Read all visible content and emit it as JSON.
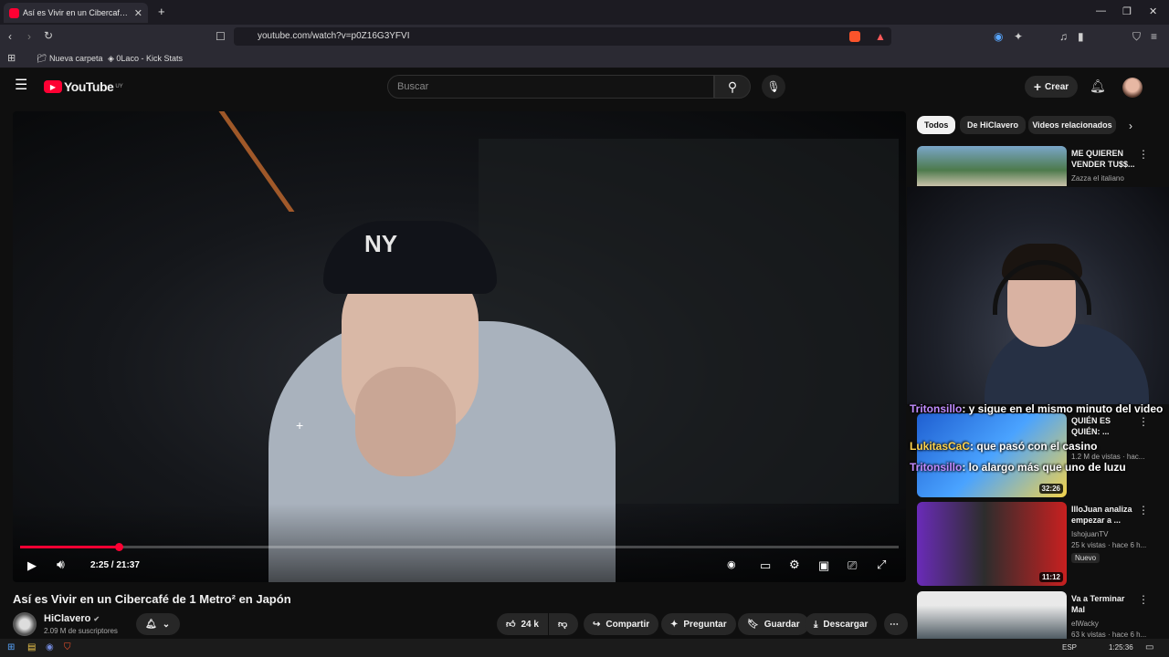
{
  "browser": {
    "tab_title": "Así es Vivir en un Cibercafé de 1 Metro² en Japón",
    "url": "youtube.com/watch?v=p0Z16G3YFVI",
    "bookmarks": [
      "Nueva carpeta",
      "0Laco - Kick Stats"
    ]
  },
  "youtube": {
    "logo": "YouTube",
    "region": "UY",
    "search_placeholder": "Buscar",
    "create_label": "Crear"
  },
  "player": {
    "time": "2:25 / 21:37",
    "progress_fraction": 0.112
  },
  "video": {
    "title": "Así es Vivir en un Cibercafé de 1 Metro² en Japón",
    "channel": "HiClavero",
    "subscribers": "2.09 M de suscriptores",
    "likes": "24 k",
    "actions": {
      "share": "Compartir",
      "ask": "Preguntar",
      "save": "Guardar",
      "download": "Descargar"
    }
  },
  "chips": [
    "Todos",
    "De HiClavero",
    "Videos relacionados"
  ],
  "recommendations": [
    {
      "title": "ME QUIEREN VENDER TU$$...",
      "channel": "Zazza el italiano",
      "meta": "",
      "duration": "",
      "badge": ""
    },
    {
      "title": "QUIÉN ES QUIÉN: ...",
      "channel": "",
      "meta": "1.2 M de vistas · hac...",
      "duration": "32:26",
      "badge": ""
    },
    {
      "title": "IlloJuan analiza empezar a ...",
      "channel": "IshojuanTV",
      "meta": "25 k vistas · hace 6 h...",
      "duration": "11:12",
      "badge": "Nuevo"
    },
    {
      "title": "Va a Terminar Mal",
      "channel": "elWacky",
      "meta": "63 k vistas · hace 6 h...",
      "duration": "",
      "badge": ""
    }
  ],
  "chat": [
    {
      "user": "Tritonsillo",
      "msg": ": y sigue en el mismo minuto del video"
    },
    {
      "user": "LukitasCaC",
      "msg": ": que pasó con el casino"
    },
    {
      "user": "Tritonsillo",
      "msg": ": lo alargo más que uno de luzu"
    }
  ],
  "taskbar": {
    "lang": "ESP",
    "time": "1:25:36"
  },
  "colors": {
    "accent": "#ff0033",
    "bg": "#0f0f0f"
  },
  "icons": [
    "back-icon",
    "forward-icon",
    "reload-icon",
    "bookmark-icon",
    "menu-icon",
    "search-icon",
    "mic-icon",
    "bell-icon",
    "play-icon",
    "volume-icon",
    "settings-icon",
    "fullscreen-icon",
    "like-icon",
    "dislike-icon",
    "share-icon",
    "save-icon",
    "download-icon"
  ]
}
